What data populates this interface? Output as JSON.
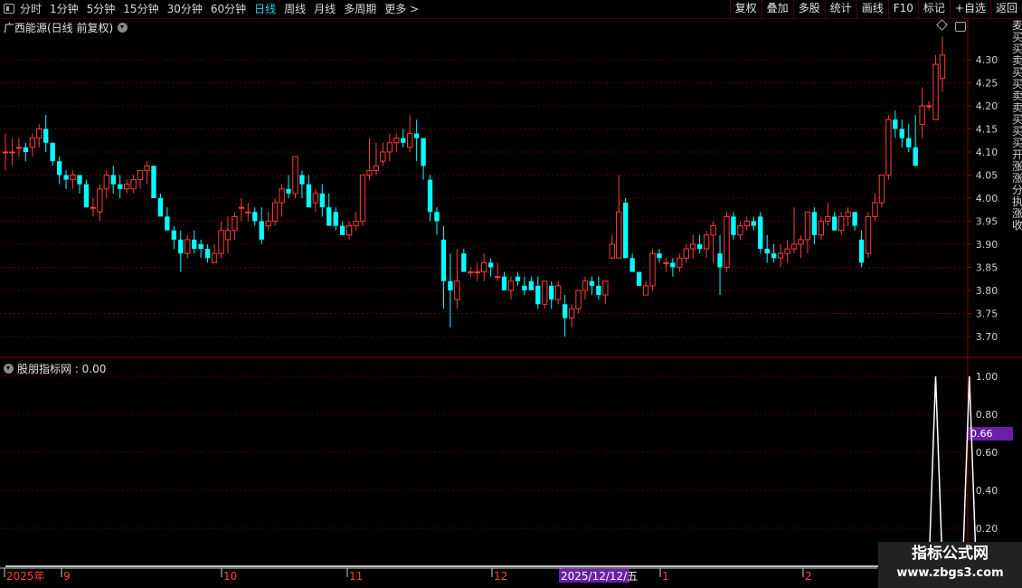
{
  "toolbar": {
    "periods": [
      "分时",
      "1分钟",
      "5分钟",
      "15分钟",
      "30分钟",
      "60分钟",
      "日线",
      "周线",
      "月线",
      "多周期",
      "更多 >"
    ],
    "active_period": "日线",
    "right_tools": [
      "复权",
      "叠加",
      "多股",
      "统计",
      "画线",
      "F10",
      "标记",
      "+自选",
      "返回"
    ]
  },
  "stock_title": "广西能源(日线 前复权)",
  "indicator_title": "股朋指标网 : 0.00",
  "side_glyphs": [
    "麦",
    "买",
    "买",
    "卖",
    "买",
    "买",
    "卖",
    "卖",
    "买",
    "买",
    "买",
    "开",
    "涨",
    "涨",
    "分",
    "执",
    "涨",
    "收"
  ],
  "watermark": {
    "line1": "指标公式网",
    "line2": "www.zbgs3.com"
  },
  "colors": {
    "up": "#ff3b3b",
    "down": "#00ffff",
    "grid": "#5a0000",
    "bg": "#000000",
    "highlight": "#6a1fa8",
    "indicator_line": "#ffffff"
  },
  "chart_data": [
    {
      "type": "candlestick",
      "ylim": [
        3.66,
        4.37
      ],
      "yticks": [
        "4.30",
        "4.25",
        "4.20",
        "4.15",
        "4.10",
        "4.05",
        "4.00",
        "3.95",
        "3.90",
        "3.85",
        "3.80",
        "3.75",
        "3.70"
      ],
      "grid": true,
      "x_labels": [
        "2025年",
        "9",
        "10",
        "11",
        "12",
        "2025/12/12/五",
        "1",
        "2"
      ],
      "highlighted_x_label": "2025/12/12/五",
      "ohlc": [
        [
          4.1,
          4.14,
          4.06,
          4.1
        ],
        [
          4.1,
          4.13,
          4.07,
          4.1
        ],
        [
          4.11,
          4.13,
          4.09,
          4.11
        ],
        [
          4.11,
          4.12,
          4.08,
          4.1
        ],
        [
          4.11,
          4.14,
          4.09,
          4.13
        ],
        [
          4.13,
          4.16,
          4.11,
          4.15
        ],
        [
          4.15,
          4.18,
          4.1,
          4.12
        ],
        [
          4.12,
          4.12,
          4.07,
          4.08
        ],
        [
          4.08,
          4.09,
          4.03,
          4.05
        ],
        [
          4.05,
          4.06,
          4.02,
          4.04
        ],
        [
          4.04,
          4.06,
          4.02,
          4.05
        ],
        [
          4.05,
          4.05,
          4.01,
          4.03
        ],
        [
          4.03,
          4.04,
          3.98,
          3.98
        ],
        [
          3.98,
          4.0,
          3.96,
          3.98
        ],
        [
          3.97,
          4.03,
          3.95,
          4.02
        ],
        [
          4.02,
          4.06,
          4.0,
          4.05
        ],
        [
          4.05,
          4.07,
          4.01,
          4.03
        ],
        [
          4.03,
          4.05,
          4.0,
          4.02
        ],
        [
          4.02,
          4.04,
          4.01,
          4.03
        ],
        [
          4.02,
          4.05,
          4.01,
          4.04
        ],
        [
          4.04,
          4.06,
          4.02,
          4.06
        ],
        [
          4.06,
          4.08,
          4.03,
          4.07
        ],
        [
          4.07,
          4.07,
          4.0,
          4.0
        ],
        [
          4.0,
          4.01,
          3.96,
          3.96
        ],
        [
          3.96,
          3.98,
          3.93,
          3.93
        ],
        [
          3.93,
          3.94,
          3.89,
          3.91
        ],
        [
          3.91,
          3.93,
          3.84,
          3.88
        ],
        [
          3.88,
          3.92,
          3.87,
          3.91
        ],
        [
          3.91,
          3.93,
          3.88,
          3.89
        ],
        [
          3.9,
          3.91,
          3.87,
          3.89
        ],
        [
          3.89,
          3.9,
          3.86,
          3.87
        ],
        [
          3.86,
          3.9,
          3.86,
          3.88
        ],
        [
          3.88,
          3.95,
          3.87,
          3.93
        ],
        [
          3.91,
          3.96,
          3.88,
          3.93
        ],
        [
          3.93,
          3.97,
          3.91,
          3.96
        ],
        [
          3.98,
          4.0,
          3.95,
          3.98
        ],
        [
          3.97,
          3.99,
          3.95,
          3.97
        ],
        [
          3.97,
          3.98,
          3.94,
          3.95
        ],
        [
          3.95,
          3.98,
          3.9,
          3.91
        ],
        [
          3.94,
          3.97,
          3.93,
          3.95
        ],
        [
          3.95,
          4.0,
          3.94,
          3.99
        ],
        [
          3.99,
          4.03,
          3.96,
          4.02
        ],
        [
          4.02,
          4.05,
          4.0,
          4.01
        ],
        [
          4.01,
          4.09,
          4.0,
          4.09
        ],
        [
          4.05,
          4.06,
          4.0,
          4.03
        ],
        [
          4.03,
          4.05,
          3.98,
          3.98
        ],
        [
          3.99,
          4.02,
          3.97,
          4.01
        ],
        [
          4.01,
          4.03,
          3.96,
          3.98
        ],
        [
          3.98,
          4.01,
          3.96,
          3.94
        ],
        [
          3.97,
          3.98,
          3.93,
          3.94
        ],
        [
          3.94,
          3.95,
          3.92,
          3.92
        ],
        [
          3.92,
          3.95,
          3.91,
          3.94
        ],
        [
          3.94,
          3.97,
          3.93,
          3.95
        ],
        [
          3.95,
          4.05,
          3.94,
          4.05
        ],
        [
          4.05,
          4.13,
          4.04,
          4.06
        ],
        [
          4.06,
          4.12,
          4.05,
          4.07
        ],
        [
          4.08,
          4.12,
          4.07,
          4.1
        ],
        [
          4.1,
          4.14,
          4.08,
          4.12
        ],
        [
          4.12,
          4.14,
          4.1,
          4.13
        ],
        [
          4.13,
          4.15,
          4.11,
          4.12
        ],
        [
          4.11,
          4.18,
          4.1,
          4.14
        ],
        [
          4.14,
          4.17,
          4.08,
          4.13
        ],
        [
          4.13,
          4.13,
          4.04,
          4.07
        ],
        [
          4.04,
          4.05,
          3.95,
          3.97
        ],
        [
          3.97,
          3.98,
          3.92,
          3.95
        ],
        [
          3.91,
          3.94,
          3.76,
          3.82
        ],
        [
          3.82,
          3.88,
          3.72,
          3.8
        ],
        [
          3.78,
          3.89,
          3.76,
          3.82
        ],
        [
          3.88,
          3.89,
          3.84,
          3.84
        ],
        [
          3.84,
          3.85,
          3.83,
          3.84
        ],
        [
          3.84,
          3.86,
          3.82,
          3.84
        ],
        [
          3.84,
          3.88,
          3.82,
          3.86
        ],
        [
          3.86,
          3.87,
          3.83,
          3.85
        ],
        [
          3.83,
          3.86,
          3.82,
          3.83
        ],
        [
          3.83,
          3.84,
          3.8,
          3.8
        ],
        [
          3.8,
          3.83,
          3.78,
          3.82
        ],
        [
          3.83,
          3.84,
          3.81,
          3.82
        ],
        [
          3.81,
          3.83,
          3.79,
          3.8
        ],
        [
          3.82,
          3.83,
          3.8,
          3.8
        ],
        [
          3.81,
          3.83,
          3.76,
          3.77
        ],
        [
          3.77,
          3.82,
          3.76,
          3.82
        ],
        [
          3.81,
          3.82,
          3.76,
          3.78
        ],
        [
          3.78,
          3.82,
          3.77,
          3.81
        ],
        [
          3.77,
          3.79,
          3.7,
          3.74
        ],
        [
          3.74,
          3.77,
          3.72,
          3.76
        ],
        [
          3.76,
          3.8,
          3.75,
          3.8
        ],
        [
          3.8,
          3.83,
          3.78,
          3.82
        ],
        [
          3.82,
          3.83,
          3.79,
          3.81
        ],
        [
          3.81,
          3.83,
          3.78,
          3.79
        ],
        [
          3.79,
          3.82,
          3.77,
          3.82
        ],
        [
          3.87,
          3.92,
          3.87,
          3.9
        ],
        [
          3.87,
          4.05,
          3.87,
          3.97
        ],
        [
          3.99,
          4.0,
          3.87,
          3.87
        ],
        [
          3.87,
          3.88,
          3.84,
          3.84
        ],
        [
          3.84,
          3.84,
          3.81,
          3.81
        ],
        [
          3.79,
          3.82,
          3.79,
          3.81
        ],
        [
          3.81,
          3.89,
          3.8,
          3.88
        ],
        [
          3.88,
          3.89,
          3.86,
          3.87
        ],
        [
          3.86,
          3.87,
          3.84,
          3.86
        ],
        [
          3.86,
          3.87,
          3.83,
          3.85
        ],
        [
          3.85,
          3.88,
          3.84,
          3.87
        ],
        [
          3.87,
          3.9,
          3.86,
          3.89
        ],
        [
          3.89,
          3.92,
          3.87,
          3.9
        ],
        [
          3.9,
          3.92,
          3.88,
          3.89
        ],
        [
          3.89,
          3.93,
          3.87,
          3.92
        ],
        [
          3.92,
          3.95,
          3.86,
          3.94
        ],
        [
          3.88,
          3.92,
          3.79,
          3.85
        ],
        [
          3.85,
          3.97,
          3.84,
          3.96
        ],
        [
          3.96,
          3.97,
          3.91,
          3.92
        ],
        [
          3.92,
          3.95,
          3.91,
          3.94
        ],
        [
          3.94,
          3.96,
          3.93,
          3.95
        ],
        [
          3.95,
          3.96,
          3.93,
          3.94
        ],
        [
          3.96,
          3.97,
          3.88,
          3.89
        ],
        [
          3.89,
          3.92,
          3.86,
          3.88
        ],
        [
          3.88,
          3.9,
          3.86,
          3.87
        ],
        [
          3.87,
          3.9,
          3.85,
          3.88
        ],
        [
          3.88,
          3.91,
          3.86,
          3.89
        ],
        [
          3.89,
          3.98,
          3.88,
          3.9
        ],
        [
          3.9,
          3.92,
          3.87,
          3.91
        ],
        [
          3.91,
          3.97,
          3.88,
          3.97
        ],
        [
          3.97,
          3.98,
          3.9,
          3.92
        ],
        [
          3.92,
          3.96,
          3.91,
          3.95
        ],
        [
          3.95,
          3.99,
          3.94,
          3.96
        ],
        [
          3.96,
          3.97,
          3.93,
          3.93
        ],
        [
          3.93,
          3.97,
          3.92,
          3.96
        ],
        [
          3.96,
          3.98,
          3.94,
          3.97
        ],
        [
          3.97,
          3.97,
          3.93,
          3.94
        ],
        [
          3.91,
          3.93,
          3.85,
          3.86
        ],
        [
          3.88,
          3.97,
          3.87,
          3.96
        ],
        [
          3.96,
          4.01,
          3.95,
          3.99
        ],
        [
          3.99,
          4.05,
          3.98,
          4.05
        ],
        [
          4.05,
          4.18,
          4.04,
          4.17
        ],
        [
          4.17,
          4.19,
          4.13,
          4.15
        ],
        [
          4.15,
          4.17,
          4.11,
          4.13
        ],
        [
          4.13,
          4.16,
          4.1,
          4.11
        ],
        [
          4.11,
          4.18,
          4.07,
          4.07
        ],
        [
          4.16,
          4.24,
          4.13,
          4.2
        ],
        [
          4.2,
          4.21,
          4.19,
          4.2
        ],
        [
          4.17,
          4.31,
          4.17,
          4.29
        ],
        [
          4.26,
          4.35,
          4.23,
          4.31
        ]
      ],
      "up_color": "#ff3b3b",
      "down_color": "#00ffff"
    },
    {
      "type": "line",
      "title": "股朋指标网 : 0.00",
      "ylim": [
        0,
        1.05
      ],
      "yticks": [
        "1.00",
        "0.80",
        "0.60",
        "0.40",
        "0.20"
      ],
      "current_value_label": "0.66",
      "values": [
        0,
        0,
        0,
        0,
        0,
        0,
        0,
        0,
        0,
        0,
        0,
        0,
        0,
        0,
        0,
        0,
        0,
        0,
        0,
        0,
        0,
        0,
        0,
        0,
        0,
        0,
        0,
        0,
        0,
        0,
        0,
        0,
        0,
        0,
        0,
        0,
        0,
        0,
        0,
        0,
        0,
        0,
        0,
        0,
        0,
        0,
        0,
        0,
        0,
        0,
        0,
        0,
        0,
        0,
        0,
        0,
        0,
        0,
        0,
        0,
        0,
        0,
        0,
        0,
        0,
        0,
        0,
        0,
        0,
        0,
        0,
        0,
        0,
        0,
        0,
        0,
        0,
        0,
        0,
        0,
        0,
        0,
        0,
        0,
        0,
        0,
        0,
        0,
        0,
        0,
        0,
        0,
        0,
        0,
        0,
        0,
        0,
        0,
        0,
        0,
        0,
        0,
        0,
        0,
        0,
        0,
        0,
        0,
        0,
        0,
        0,
        0,
        0,
        0,
        0,
        0,
        0,
        0,
        0,
        0,
        0,
        0,
        0,
        0,
        0,
        0,
        0,
        0,
        0,
        0,
        0,
        0,
        0,
        0,
        0,
        0,
        0,
        0,
        1,
        0,
        0,
        0,
        0,
        1,
        0
      ]
    }
  ]
}
